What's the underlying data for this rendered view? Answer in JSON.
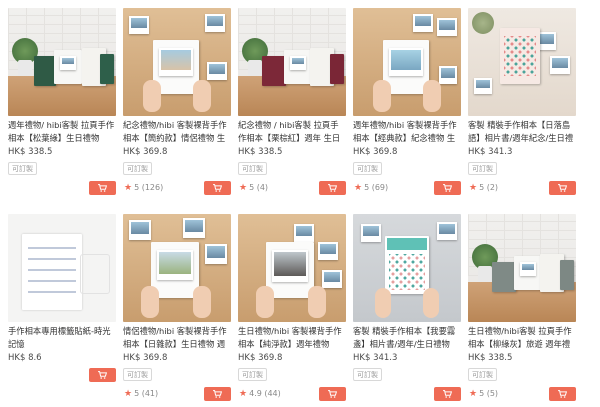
{
  "colors": {
    "accent": "#ef6b55",
    "price": "#4a4a4a",
    "star": "#ef6b55"
  },
  "products": [
    {
      "name": "週年禮物/ hibi客製 拉頁手作相本【松葉綠】生日禮物",
      "price": "HK$ 338.5",
      "badge": "可訂製",
      "rating": "",
      "icon": "cart-icon"
    },
    {
      "name": "紀念禮物/hibi 客製裸背手作相本【簡約款】情侶禮物 生日...",
      "price": "HK$ 369.8",
      "badge": "可訂製",
      "rating": "5 (126)",
      "icon": "cart-icon"
    },
    {
      "name": "紀念禮物 / hibi客製 拉頁手作相本【栗棕紅】週年 生日禮物",
      "price": "HK$ 338.5",
      "badge": "可訂製",
      "rating": "5 (4)",
      "icon": "cart-icon"
    },
    {
      "name": "週年禮物/hibi 客製裸背手作相本【經典款】紀念禮物 生日...",
      "price": "HK$ 369.8",
      "badge": "可訂製",
      "rating": "5 (69)",
      "icon": "cart-icon"
    },
    {
      "name": "客製 精裝手作相本【日落島語】相片書/週年紀念/生日禮物",
      "price": "HK$ 341.3",
      "badge": "可訂製",
      "rating": "5 (2)",
      "icon": "cart-icon"
    },
    {
      "name": "手作相本專用標籤貼紙-時光記憶",
      "price": "HK$ 8.6",
      "badge": "",
      "rating": "",
      "icon": "cart-icon"
    },
    {
      "name": "情侶禮物/hibi 客製裸背手作相本【日雜款】生日禮物 週年...",
      "price": "HK$ 369.8",
      "badge": "可訂製",
      "rating": "5 (41)",
      "icon": "cart-icon"
    },
    {
      "name": "生日禮物/hibi 客製裸背手作相本【純淨款】週年禮物",
      "price": "HK$ 369.8",
      "badge": "可訂製",
      "rating": "4.9 (44)",
      "icon": "cart-icon"
    },
    {
      "name": "客製 精裝手作相本【我要霧盞】相片書/週年/生日禮物",
      "price": "HK$ 341.3",
      "badge": "可訂製",
      "rating": "",
      "icon": "cart-icon"
    },
    {
      "name": "生日禮物/hibi客製 拉頁手作相本【柳綠灰】旅遊 週年禮物",
      "price": "HK$ 338.5",
      "badge": "可訂製",
      "rating": "5 (5)",
      "icon": "cart-icon"
    }
  ]
}
